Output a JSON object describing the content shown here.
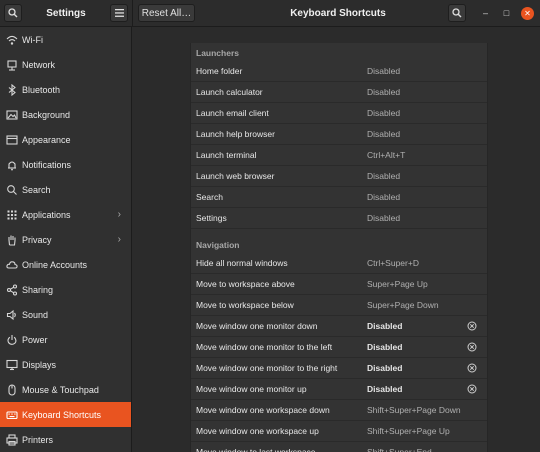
{
  "header": {
    "settings_title": "Settings",
    "reset_label": "Reset All…",
    "main_title": "Keyboard Shortcuts",
    "minimize_glyph": "–",
    "maximize_glyph": "□",
    "close_glyph": "✕",
    "accent_color": "#e95420"
  },
  "sidebar": {
    "items": [
      {
        "label": "Wi-Fi",
        "icon": "wifi-icon"
      },
      {
        "label": "Network",
        "icon": "network-icon"
      },
      {
        "label": "Bluetooth",
        "icon": "bluetooth-icon"
      },
      {
        "label": "Background",
        "icon": "background-icon"
      },
      {
        "label": "Appearance",
        "icon": "appearance-icon"
      },
      {
        "label": "Notifications",
        "icon": "bell-icon"
      },
      {
        "label": "Search",
        "icon": "search-icon"
      },
      {
        "label": "Applications",
        "icon": "grid-icon"
      },
      {
        "label": "Privacy",
        "icon": "hand-icon"
      },
      {
        "label": "Online Accounts",
        "icon": "cloud-icon"
      },
      {
        "label": "Sharing",
        "icon": "share-icon"
      },
      {
        "label": "Sound",
        "icon": "speaker-icon"
      },
      {
        "label": "Power",
        "icon": "power-icon"
      },
      {
        "label": "Displays",
        "icon": "display-icon"
      },
      {
        "label": "Mouse & Touchpad",
        "icon": "mouse-icon"
      },
      {
        "label": "Keyboard Shortcuts",
        "icon": "keyboard-icon",
        "active": true
      },
      {
        "label": "Printers",
        "icon": "printer-icon"
      }
    ],
    "arrow_glyph": "›"
  },
  "shortcuts": {
    "launchers": {
      "title": "Launchers",
      "rows": [
        {
          "name": "Home folder",
          "accel": "Disabled"
        },
        {
          "name": "Launch calculator",
          "accel": "Disabled"
        },
        {
          "name": "Launch email client",
          "accel": "Disabled"
        },
        {
          "name": "Launch help browser",
          "accel": "Disabled"
        },
        {
          "name": "Launch terminal",
          "accel": "Ctrl+Alt+T"
        },
        {
          "name": "Launch web browser",
          "accel": "Disabled"
        },
        {
          "name": "Search",
          "accel": "Disabled"
        },
        {
          "name": "Settings",
          "accel": "Disabled"
        }
      ]
    },
    "navigation": {
      "title": "Navigation",
      "rows": [
        {
          "name": "Hide all normal windows",
          "accel": "Ctrl+Super+D"
        },
        {
          "name": "Move to workspace above",
          "accel": "Super+Page Up"
        },
        {
          "name": "Move to workspace below",
          "accel": "Super+Page Down"
        },
        {
          "name": "Move window one monitor down",
          "accel": "Disabled",
          "modified": true
        },
        {
          "name": "Move window one monitor to the left",
          "accel": "Disabled",
          "modified": true
        },
        {
          "name": "Move window one monitor to the right",
          "accel": "Disabled",
          "modified": true
        },
        {
          "name": "Move window one monitor up",
          "accel": "Disabled",
          "modified": true
        },
        {
          "name": "Move window one workspace down",
          "accel": "Shift+Super+Page Down"
        },
        {
          "name": "Move window one workspace up",
          "accel": "Shift+Super+Page Up"
        },
        {
          "name": "Move window to last workspace",
          "accel": "Shift+Super+End"
        }
      ]
    }
  }
}
